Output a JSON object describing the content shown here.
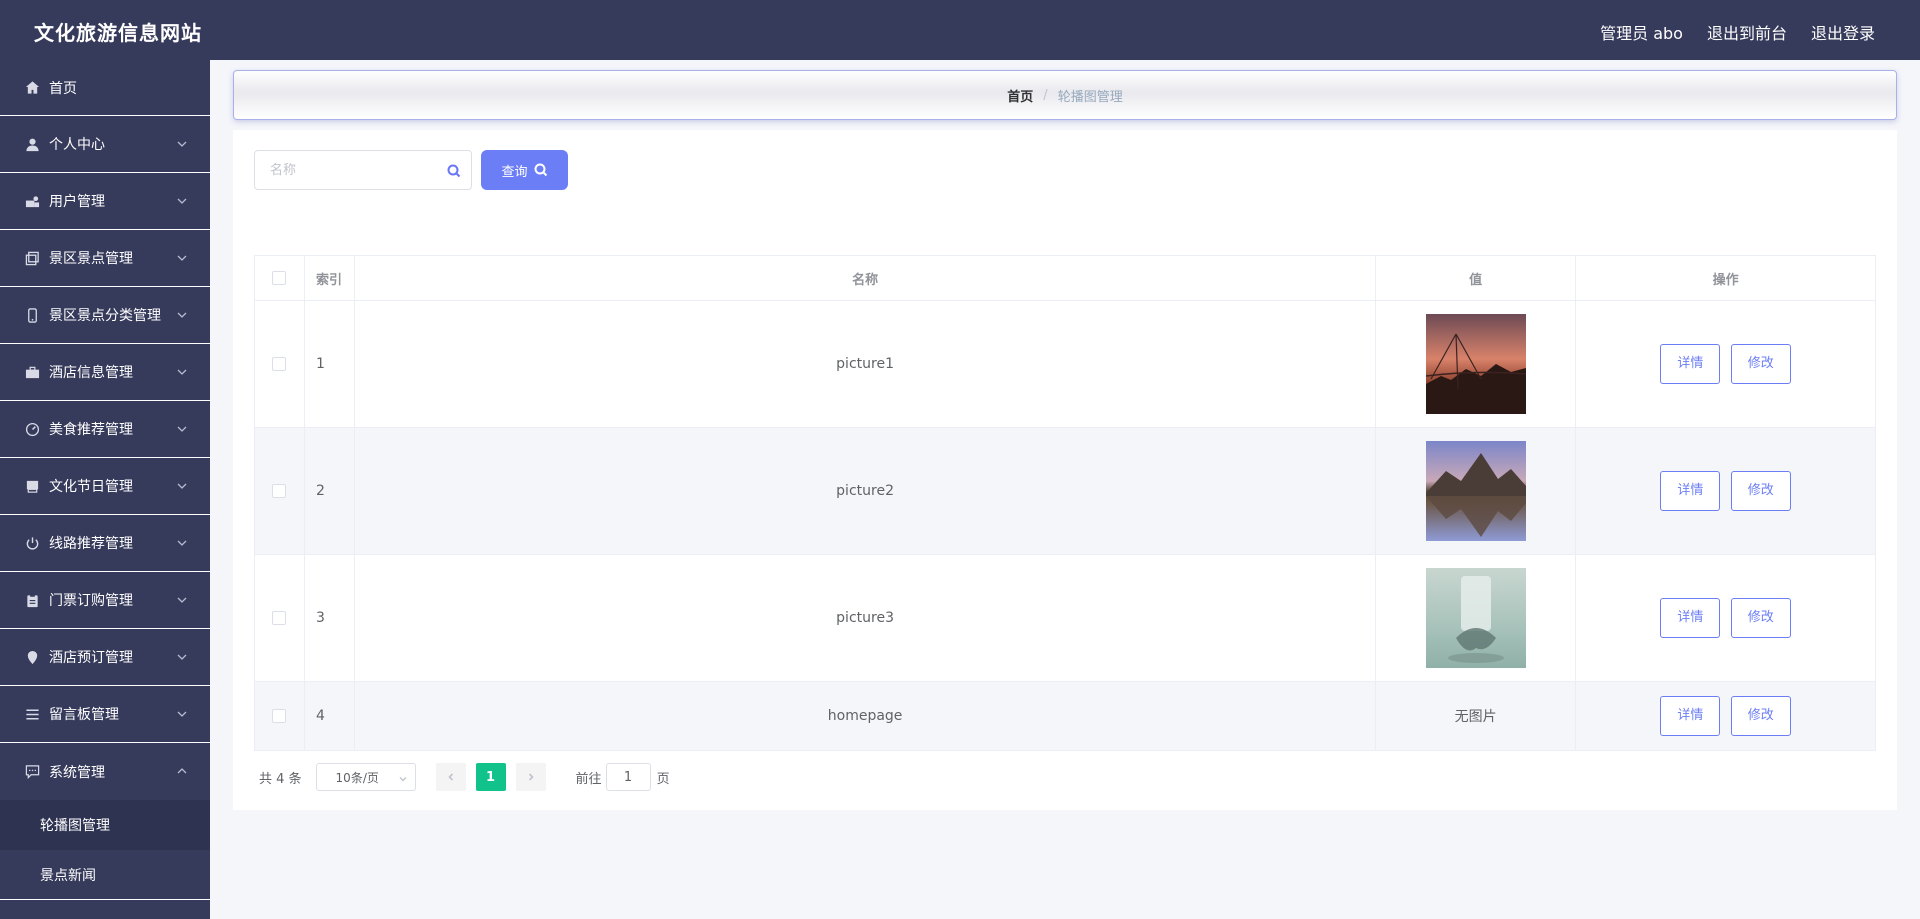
{
  "header": {
    "title": "文化旅游信息网站",
    "user_label": "管理员 abo",
    "to_front_label": "退出到前台",
    "logout_label": "退出登录"
  },
  "sidebar": {
    "items": [
      {
        "label": "首页",
        "icon": "home-icon"
      },
      {
        "label": "个人中心",
        "icon": "person-icon"
      },
      {
        "label": "用户管理",
        "icon": "users-icon"
      },
      {
        "label": "景区景点管理",
        "icon": "copy-icon"
      },
      {
        "label": "景区景点分类管理",
        "icon": "mobile-icon"
      },
      {
        "label": "酒店信息管理",
        "icon": "briefcase-icon"
      },
      {
        "label": "美食推荐管理",
        "icon": "gauge-icon"
      },
      {
        "label": "文化节日管理",
        "icon": "printer-icon"
      },
      {
        "label": "线路推荐管理",
        "icon": "power-icon"
      },
      {
        "label": "门票订购管理",
        "icon": "clipboard-icon"
      },
      {
        "label": "酒店预订管理",
        "icon": "location-icon"
      },
      {
        "label": "留言板管理",
        "icon": "list-icon"
      },
      {
        "label": "系统管理",
        "icon": "chat-icon"
      }
    ],
    "submenu": [
      {
        "label": "轮播图管理",
        "active": true
      },
      {
        "label": "景点新闻",
        "active": false
      }
    ]
  },
  "breadcrumb": {
    "home": "首页",
    "separator": "/",
    "current": "轮播图管理"
  },
  "search": {
    "placeholder": "名称",
    "button_label": "查询"
  },
  "table": {
    "headers": [
      "索引",
      "名称",
      "值",
      "操作"
    ],
    "detail_label": "详情",
    "edit_label": "修改",
    "rows": [
      {
        "index": "1",
        "name": "picture1",
        "value_image": "sunset-bridge-image"
      },
      {
        "index": "2",
        "name": "picture2",
        "value_image": "mountain-lake-image"
      },
      {
        "index": "3",
        "name": "picture3",
        "value_image": "glass-sculpture-image"
      },
      {
        "index": "4",
        "name": "homepage",
        "value_text": "无图片"
      }
    ]
  },
  "pagination": {
    "total_label": "共 4 条",
    "page_size": "10条/页",
    "current_page": "1",
    "jump_prefix": "前往",
    "jump_value": "1",
    "jump_suffix": "页"
  },
  "colors": {
    "topbar": "#363a5b",
    "accent": "#6c7ef6",
    "active_page": "#11c28b"
  }
}
